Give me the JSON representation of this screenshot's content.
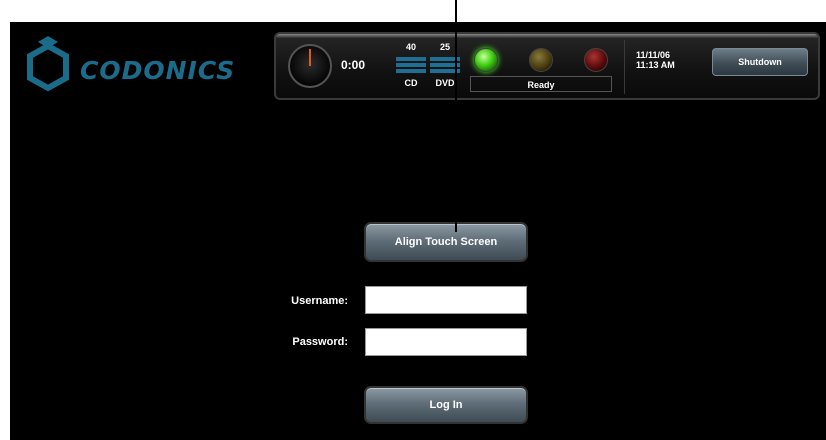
{
  "logo": {
    "text": "CODONICS"
  },
  "status_bar": {
    "time": "0:00",
    "cd_count": "40",
    "cd_label": "CD",
    "dvd_count": "25",
    "dvd_label": "DVD",
    "status_text": "Ready",
    "date": "11/11/06",
    "clock": "11:13 AM",
    "shutdown_label": "Shutdown"
  },
  "main": {
    "align_label": "Align Touch Screen",
    "username_label": "Username:",
    "password_label": "Password:",
    "username_value": "",
    "password_value": "",
    "login_label": "Log In"
  },
  "colors": {
    "background": "#000000",
    "logo": "#1b6b8a",
    "ready_lamp": "#3fcf10",
    "button": "#5f6e78"
  }
}
